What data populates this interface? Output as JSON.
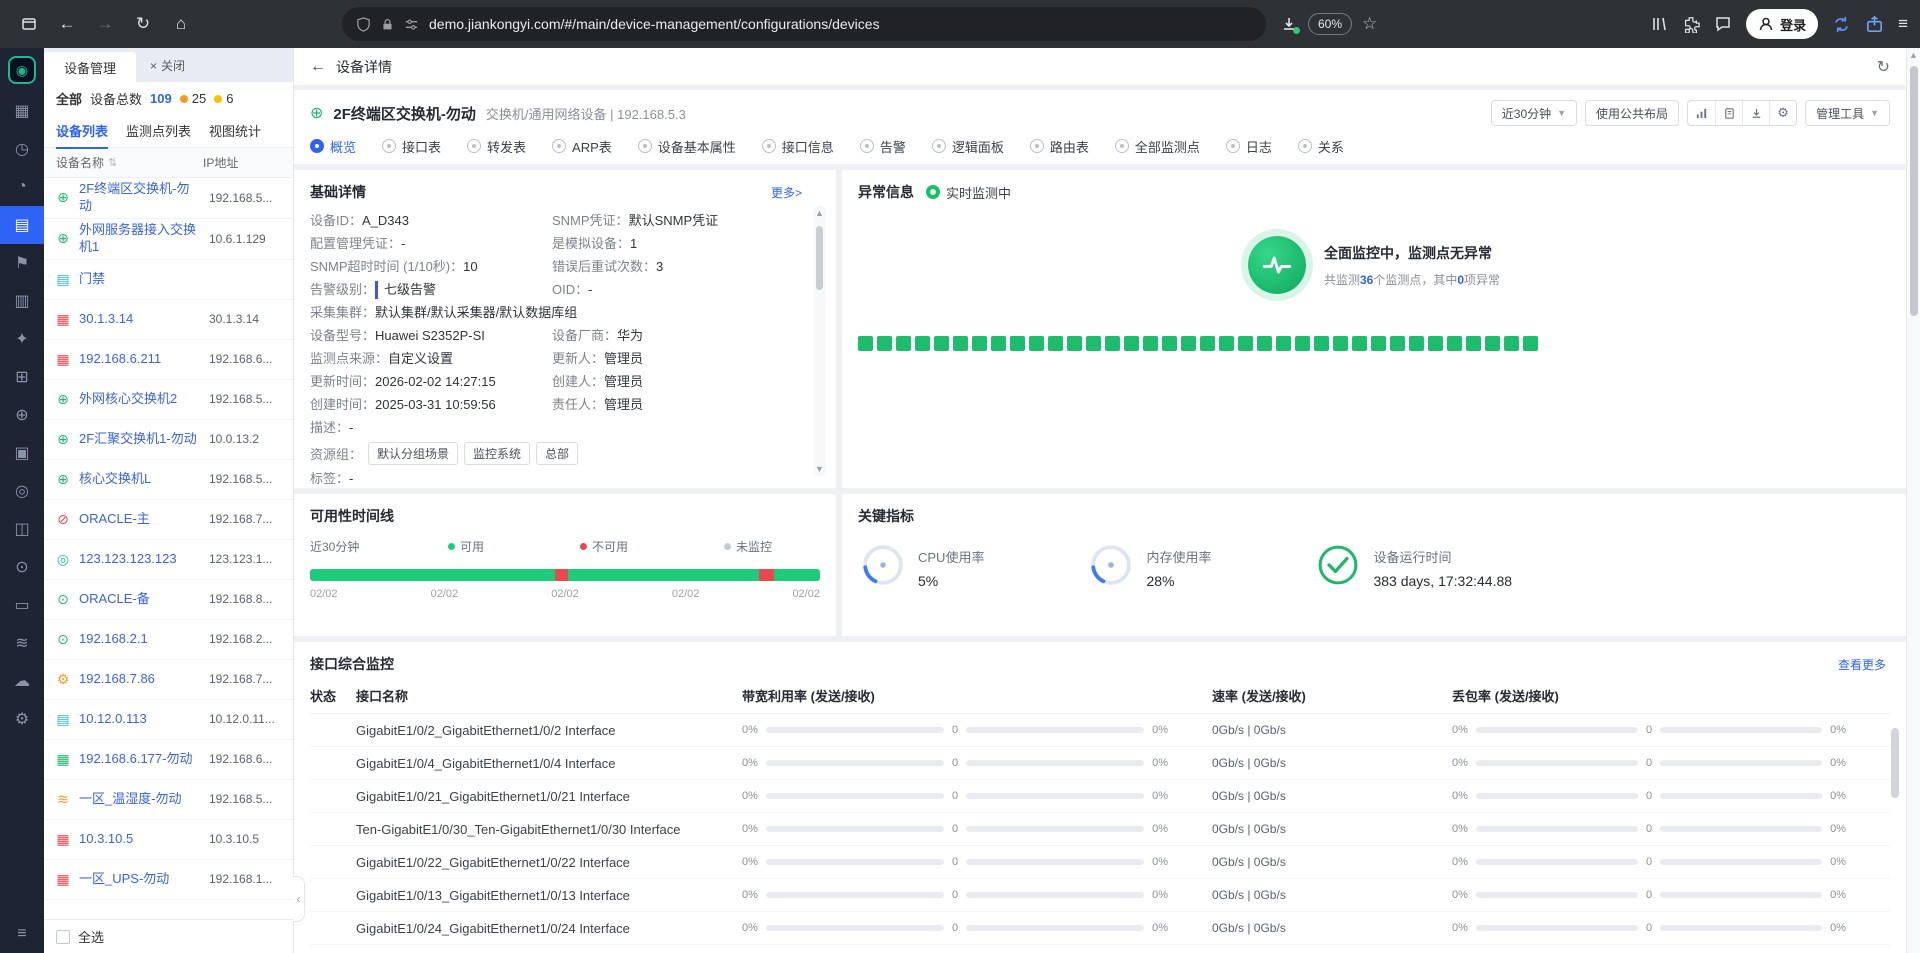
{
  "browser": {
    "url": "demo.jiankongyi.com/#/main/device-management/configurations/devices",
    "zoom": "60%",
    "login_label": "登录"
  },
  "rail": {
    "items": [
      {
        "item_name": "sidebar-item-dashboard",
        "icon_name": "dashboard-icon",
        "glyph": "▦",
        "state": ""
      },
      {
        "item_name": "sidebar-item-history",
        "icon_name": "history-icon",
        "glyph": "◷",
        "state": ""
      },
      {
        "item_name": "sidebar-item-alarms",
        "icon_name": "alarm-icon",
        "glyph": "◔",
        "state": ""
      },
      {
        "item_name": "sidebar-item-devices",
        "icon_name": "device-list-icon",
        "glyph": "▤",
        "state": "active"
      },
      {
        "item_name": "sidebar-item-announce",
        "icon_name": "flag-icon",
        "glyph": "⚑",
        "state": ""
      },
      {
        "item_name": "sidebar-item-reports",
        "icon_name": "report-icon",
        "glyph": "▥",
        "state": ""
      },
      {
        "item_name": "sidebar-item-favorites",
        "icon_name": "star-icon",
        "glyph": "✦",
        "state": ""
      },
      {
        "item_name": "sidebar-item-topology",
        "icon_name": "topology-icon",
        "glyph": "⊞",
        "state": ""
      },
      {
        "item_name": "sidebar-item-network",
        "icon_name": "network-icon",
        "glyph": "⊕",
        "state": ""
      },
      {
        "item_name": "sidebar-item-assets",
        "icon_name": "asset-icon",
        "glyph": "▣",
        "state": ""
      },
      {
        "item_name": "sidebar-item-targets",
        "icon_name": "target-icon",
        "glyph": "◎",
        "state": ""
      },
      {
        "item_name": "sidebar-item-display",
        "icon_name": "display-icon",
        "glyph": "◫",
        "state": ""
      },
      {
        "item_name": "sidebar-item-nodes",
        "icon_name": "nodes-icon",
        "glyph": "⊙",
        "state": ""
      },
      {
        "item_name": "sidebar-item-docs",
        "icon_name": "document-icon",
        "glyph": "▭",
        "state": ""
      },
      {
        "item_name": "sidebar-item-monitor",
        "icon_name": "wave-icon",
        "glyph": "≋",
        "state": ""
      },
      {
        "item_name": "sidebar-item-cloud",
        "icon_name": "cloud-icon",
        "glyph": "☁",
        "state": ""
      },
      {
        "item_name": "sidebar-item-settings",
        "icon_name": "gear-icon",
        "glyph": "⚙",
        "state": ""
      }
    ]
  },
  "panel": {
    "tab_title": "设备管理",
    "close_glyph": "×",
    "close_all": "关闭",
    "filter_all": "全部",
    "total_label": "设备总数",
    "total_value": "109",
    "count1": "25",
    "count2": "6",
    "subtabs": [
      {
        "name": "tab-device-list",
        "label": "设备列表",
        "state": "active"
      },
      {
        "name": "tab-monitor-list",
        "label": "监测点列表",
        "state": ""
      },
      {
        "name": "tab-view-stats",
        "label": "视图统计",
        "state": ""
      }
    ],
    "columns": {
      "name": "设备名称",
      "ip": "IP地址"
    },
    "select_all": "全选",
    "devices": [
      {
        "icon": "switch-icon",
        "glyph": "⊕",
        "color": "green",
        "name": "2F终端区交换机-勿动",
        "ip": "192.168.5..."
      },
      {
        "icon": "switch-icon",
        "glyph": "⊕",
        "color": "green",
        "name": "外网服务器接入交换机1",
        "ip": "10.6.1.129"
      },
      {
        "icon": "access-icon",
        "glyph": "▤",
        "color": "cyan",
        "name": "门禁",
        "ip": ""
      },
      {
        "icon": "device-icon",
        "glyph": "▦",
        "color": "red",
        "name": "30.1.3.14",
        "ip": "30.1.3.14"
      },
      {
        "icon": "device-icon",
        "glyph": "▦",
        "color": "red",
        "name": "192.168.6.211",
        "ip": "192.168.6..."
      },
      {
        "icon": "switch-icon",
        "glyph": "⊕",
        "color": "green",
        "name": "外网核心交换机2",
        "ip": "192.168.5..."
      },
      {
        "icon": "switch-icon",
        "glyph": "⊕",
        "color": "green",
        "name": "2F汇聚交换机1-勿动",
        "ip": "10.0.13.2"
      },
      {
        "icon": "switch-icon",
        "glyph": "⊕",
        "color": "green",
        "name": "核心交换机L",
        "ip": "192.168.5..."
      },
      {
        "icon": "database-icon",
        "glyph": "⊘",
        "color": "red",
        "name": "ORACLE-主",
        "ip": "192.168.7..."
      },
      {
        "icon": "host-icon",
        "glyph": "◎",
        "color": "teal",
        "name": "123.123.123.123",
        "ip": "123.123.1..."
      },
      {
        "icon": "database-icon",
        "glyph": "⊙",
        "color": "green",
        "name": "ORACLE-备",
        "ip": "192.168.8..."
      },
      {
        "icon": "host-icon",
        "glyph": "⊙",
        "color": "green",
        "name": "192.168.2.1",
        "ip": "192.168.2..."
      },
      {
        "icon": "service-icon",
        "glyph": "⚙",
        "color": "orange",
        "name": "192.168.7.86",
        "ip": "192.168.7..."
      },
      {
        "icon": "access-icon",
        "glyph": "▤",
        "color": "cyan",
        "name": "10.12.0.113",
        "ip": "10.12.0.11..."
      },
      {
        "icon": "device-icon",
        "glyph": "▦",
        "color": "green",
        "name": "192.168.6.177-勿动",
        "ip": "192.168.6..."
      },
      {
        "icon": "sensor-icon",
        "glyph": "≋",
        "color": "orange",
        "name": "一区_温湿度-勿动",
        "ip": "192.168.5..."
      },
      {
        "icon": "device-icon",
        "glyph": "▦",
        "color": "red",
        "name": "10.3.10.5",
        "ip": "10.3.10.5"
      },
      {
        "icon": "device-icon",
        "glyph": "▦",
        "color": "red",
        "name": "一区_UPS-勿动",
        "ip": "192.168.1..."
      }
    ]
  },
  "detail": {
    "back_title": "设备详情",
    "device_name": "2F终端区交换机-勿动",
    "device_sub": "交换机/通用网络设备 | 192.168.5.3",
    "toolbar": {
      "time_range": "近30分钟",
      "layout_btn": "使用公共布局",
      "manage_tools": "管理工具"
    },
    "tabs": [
      {
        "name": "tab-overview",
        "label": "概览",
        "state": "active"
      },
      {
        "name": "tab-interface-table",
        "label": "接口表",
        "state": ""
      },
      {
        "name": "tab-forwarding-table",
        "label": "转发表",
        "state": ""
      },
      {
        "name": "tab-arp-table",
        "label": "ARP表",
        "state": ""
      },
      {
        "name": "tab-device-properties",
        "label": "设备基本属性",
        "state": ""
      },
      {
        "name": "tab-interface-info",
        "label": "接口信息",
        "state": ""
      },
      {
        "name": "tab-alarms",
        "label": "告警",
        "state": ""
      },
      {
        "name": "tab-logical-panel",
        "label": "逻辑面板",
        "state": ""
      },
      {
        "name": "tab-routing-table",
        "label": "路由表",
        "state": ""
      },
      {
        "name": "tab-all-monitors",
        "label": "全部监测点",
        "state": ""
      },
      {
        "name": "tab-logs",
        "label": "日志",
        "state": ""
      },
      {
        "name": "tab-relations",
        "label": "关系",
        "state": ""
      }
    ],
    "basic": {
      "title": "基础详情",
      "more": "更多>",
      "fields": [
        {
          "label": "设备ID：",
          "value": "A_D343",
          "cls": ""
        },
        {
          "label": "SNMP凭证：",
          "value": "默认SNMP凭证",
          "cls": ""
        },
        {
          "label": "配置管理凭证：",
          "value": "-",
          "cls": ""
        },
        {
          "label": "是模拟设备：",
          "value": "1",
          "cls": ""
        },
        {
          "label": "SNMP超时时间 (1/10秒)：",
          "value": "10",
          "cls": ""
        },
        {
          "label": "错误后重试次数：",
          "value": "3",
          "cls": ""
        },
        {
          "label": "告警级别：",
          "value": "七级告警",
          "cls": "levelbar"
        },
        {
          "label": "OID：",
          "value": "-",
          "cls": ""
        },
        {
          "label": "采集集群：",
          "value": "默认集群/默认采集器/默认数据库组",
          "cls": "wide"
        },
        {
          "label": "设备型号：",
          "value": "Huawei S2352P-SI",
          "cls": ""
        },
        {
          "label": "设备厂商：",
          "value": "华为",
          "cls": ""
        },
        {
          "label": "监测点来源：",
          "value": "自定义设置",
          "cls": ""
        },
        {
          "label": "更新人：",
          "value": "管理员",
          "cls": ""
        },
        {
          "label": "更新时间：",
          "value": "2026-02-02 14:27:15",
          "cls": ""
        },
        {
          "label": "创建人：",
          "value": "管理员",
          "cls": ""
        },
        {
          "label": "创建时间：",
          "value": "2025-03-31 10:59:56",
          "cls": ""
        },
        {
          "label": "责任人：",
          "value": "管理员",
          "cls": ""
        },
        {
          "label": "描述：",
          "value": "-",
          "cls": "wide"
        }
      ],
      "tags_label": "资源组：",
      "tags": [
        "默认分组场景",
        "监控系统",
        "总部"
      ],
      "label_label": "标签：",
      "label_value": "-"
    },
    "abnormal": {
      "title": "异常信息",
      "live_badge": "实时监测中",
      "status_main": "全面监控中，监测点无异常",
      "sub_prefix": "共监测",
      "monitor_count": "36",
      "sub_mid": "个监测点，其中",
      "abnormal_count": "0",
      "sub_suffix": "项异常",
      "squares": 36,
      "square_color": "#1ebd6e"
    },
    "availability": {
      "title": "可用性时间线",
      "range": "近30分钟",
      "legend": [
        {
          "label": "可用",
          "cls": "lg-green"
        },
        {
          "label": "不可用",
          "cls": "lg-red"
        },
        {
          "label": "未监控",
          "cls": "lg-gray"
        }
      ],
      "segments": [
        {
          "color": "#1ecb7b",
          "width": 48
        },
        {
          "color": "#e8484f",
          "width": 2.6
        },
        {
          "color": "#1ecb7b",
          "width": 37.4
        },
        {
          "color": "#e8484f",
          "width": 3
        },
        {
          "color": "#1ecb7b",
          "width": 9
        }
      ],
      "x_labels": [
        "02/02",
        "02/02",
        "02/02",
        "02/02",
        "02/02"
      ]
    },
    "kpi": {
      "title": "关键指标",
      "items": [
        {
          "name": "kpi-cpu",
          "icon": "gauge-icon",
          "label": "CPU使用率",
          "value": "5%",
          "kind": "gauge"
        },
        {
          "name": "kpi-memory",
          "icon": "gauge-icon",
          "label": "内存使用率",
          "value": "28%",
          "kind": "gauge"
        },
        {
          "name": "kpi-uptime",
          "icon": "check-icon",
          "label": "设备运行时间",
          "value": "383 days, 17:32:44.88",
          "kind": "check"
        }
      ]
    },
    "interfaces": {
      "title": "接口综合监控",
      "more": "查看更多",
      "columns": [
        "状态",
        "接口名称",
        "带宽利用率 (发送/接收)",
        "速率 (发送/接收)",
        "丢包率 (发送/接收)"
      ],
      "rows": [
        {
          "name": "GigabitE1/0/2_GigabitEthernet1/0/2 Interface",
          "bw1": "0%",
          "bwm": "0",
          "bw2": "0%",
          "rate": "0Gb/s | 0Gb/s",
          "ls1": "0%",
          "lsm": "0",
          "ls2": "0%"
        },
        {
          "name": "GigabitE1/0/4_GigabitEthernet1/0/4 Interface",
          "bw1": "0%",
          "bwm": "0",
          "bw2": "0%",
          "rate": "0Gb/s | 0Gb/s",
          "ls1": "0%",
          "lsm": "0",
          "ls2": "0%"
        },
        {
          "name": "GigabitE1/0/21_GigabitEthernet1/0/21 Interface",
          "bw1": "0%",
          "bwm": "0",
          "bw2": "0%",
          "rate": "0Gb/s | 0Gb/s",
          "ls1": "0%",
          "lsm": "0",
          "ls2": "0%"
        },
        {
          "name": "Ten-GigabitE1/0/30_Ten-GigabitEthernet1/0/30 Interface",
          "bw1": "0%",
          "bwm": "0",
          "bw2": "0%",
          "rate": "0Gb/s | 0Gb/s",
          "ls1": "0%",
          "lsm": "0",
          "ls2": "0%"
        },
        {
          "name": "GigabitE1/0/22_GigabitEthernet1/0/22 Interface",
          "bw1": "0%",
          "bwm": "0",
          "bw2": "0%",
          "rate": "0Gb/s | 0Gb/s",
          "ls1": "0%",
          "lsm": "0",
          "ls2": "0%"
        },
        {
          "name": "GigabitE1/0/13_GigabitEthernet1/0/13 Interface",
          "bw1": "0%",
          "bwm": "0",
          "bw2": "0%",
          "rate": "0Gb/s | 0Gb/s",
          "ls1": "0%",
          "lsm": "0",
          "ls2": "0%"
        },
        {
          "name": "GigabitE1/0/24_GigabitEthernet1/0/24 Interface",
          "bw1": "0%",
          "bwm": "0",
          "bw2": "0%",
          "rate": "0Gb/s | 0Gb/s",
          "ls1": "0%",
          "lsm": "0",
          "ls2": "0%"
        }
      ]
    }
  }
}
